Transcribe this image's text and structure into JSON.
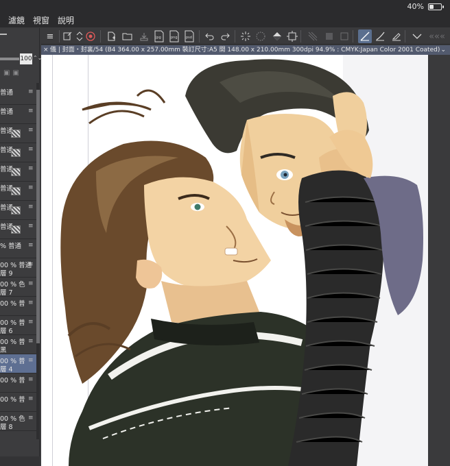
{
  "status": {
    "battery_percent": "40%",
    "battery_level": 0.4
  },
  "menu": [
    "濾鏡",
    "視窗",
    "說明"
  ],
  "toolbar": {
    "icons": [
      "menu-icon",
      "new-file-icon",
      "updown-icon",
      "record-icon",
      "new-canvas-icon",
      "open-folder-icon",
      "save-icon",
      "export-jpg-icon",
      "export-png-icon",
      "export-psd-icon",
      "undo-icon",
      "redo-icon",
      "sparkle-icon",
      "dotted-circle-icon",
      "fill-icon",
      "transform-icon",
      "grid-icon",
      "square-icon",
      "box-icon",
      "pen-icon",
      "brush-icon",
      "eraser-icon",
      "chevron-down-icon"
    ],
    "jpg": "jpg",
    "png": "png",
    "psd": "psd"
  },
  "left_panel": {
    "opacity": "100",
    "layers": [
      {
        "l1": "普通",
        "l2": ""
      },
      {
        "l1": "普通",
        "l2": ""
      },
      {
        "l1": "普通",
        "l2": ""
      },
      {
        "l1": "普通",
        "l2": ""
      },
      {
        "l1": "普通",
        "l2": ""
      },
      {
        "l1": "普通",
        "l2": ""
      },
      {
        "l1": "普通",
        "l2": ""
      },
      {
        "l1": "普通",
        "l2": ""
      },
      {
        "l1": "% 普通",
        "l2": ""
      },
      {
        "l1": "00 % 普通",
        "l2": "層 9"
      },
      {
        "l1": "00 % 色",
        "l2": "層 7"
      },
      {
        "l1": "00 % 普",
        "l2": ""
      },
      {
        "l1": "00 % 普",
        "l2": "層 6"
      },
      {
        "l1": "00 % 普",
        "l2": "黑"
      },
      {
        "l1": "00 % 普",
        "l2": "層 4"
      },
      {
        "l1": "00 % 普",
        "l2": ""
      },
      {
        "l1": "00 % 普",
        "l2": ""
      },
      {
        "l1": "00 % 色",
        "l2": "層 8"
      }
    ]
  },
  "document": {
    "tab_title": "儀 | 封面・封裏/54 (B4 364.00 x 257.00mm 裝訂尺寸:A5 開 148.00 x 210.00mm 300dpi 94.9% : CMYK:Japan Color 2001 Coated)"
  },
  "colors": {
    "app_bg": "#3a3a3c",
    "menubar_bg": "#2b2b2d",
    "selection": "#5e6f92",
    "doctab_bg": "#525a6e",
    "paper": "#ffffff"
  },
  "artwork": {
    "type": "illustration"
  }
}
